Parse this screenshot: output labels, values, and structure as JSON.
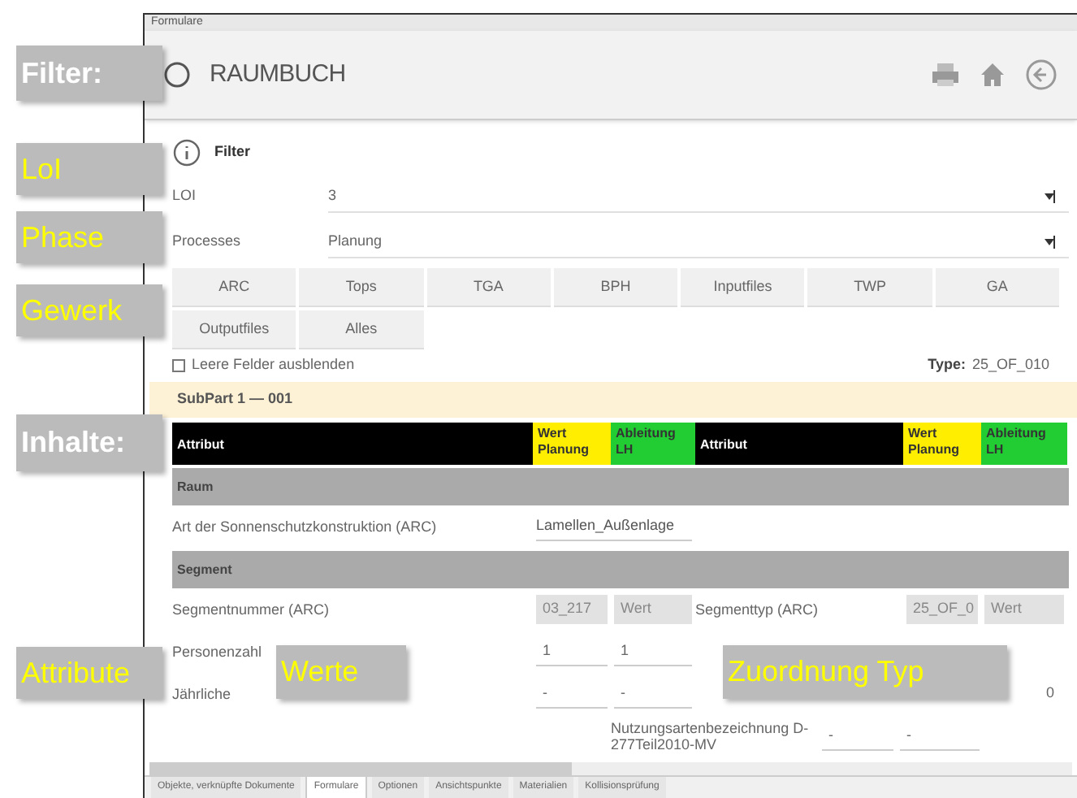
{
  "window": {
    "title": "Formulare"
  },
  "header": {
    "title": "RAUMBUCH"
  },
  "filter": {
    "title": "Filter",
    "fields": [
      {
        "label": "LOI",
        "value": "3"
      },
      {
        "label": "Processes",
        "value": "Planung"
      }
    ],
    "trade_buttons": [
      {
        "label": "ARC"
      },
      {
        "label": "Tops"
      },
      {
        "label": "TGA"
      },
      {
        "label": "BPH"
      },
      {
        "label": "Inputfiles"
      },
      {
        "label": "TWP"
      },
      {
        "label": "GA"
      },
      {
        "label": "Outputfiles"
      },
      {
        "label": "Alles"
      }
    ],
    "hide_empty": {
      "label": "Leere Felder ausblenden",
      "checked": false
    },
    "type": {
      "label": "Type:",
      "value": "25_OF_010"
    }
  },
  "subpart": "SubPart 1 — 001",
  "table": {
    "columns": [
      "Attribut",
      "Wert Planung",
      "Ableitung LH",
      "Attribut",
      "Wert Planung",
      "Ableitung LH"
    ],
    "sections": [
      {
        "title": "Raum",
        "rows": [
          {
            "cells": [
              {
                "text": "Art der Sonnenschutzkonstruktion (ARC)",
                "kind": "label"
              },
              {
                "text": "Lamellen_Außenlage",
                "kind": "wide"
              },
              {
                "kind": "empty"
              },
              {
                "kind": "empty"
              },
              {
                "kind": "empty"
              }
            ]
          }
        ]
      },
      {
        "title": "Segment",
        "rows": [
          {
            "cells": [
              {
                "text": "Segmentnummer (ARC)",
                "kind": "label"
              },
              {
                "text": "03_217",
                "kind": "filled"
              },
              {
                "text": "Wert",
                "kind": "filled"
              },
              {
                "text": "Segmenttyp (ARC)",
                "kind": "label"
              },
              {
                "text": "25_OF_0",
                "kind": "filled"
              },
              {
                "text": "Wert",
                "kind": "filled"
              }
            ]
          },
          {
            "cells": [
              {
                "text": "Personenzahl",
                "kind": "label"
              },
              {
                "text": "1",
                "kind": "input"
              },
              {
                "text": "1",
                "kind": "input"
              },
              {
                "kind": "empty"
              },
              {
                "kind": "empty"
              },
              {
                "kind": "empty"
              }
            ]
          },
          {
            "cells": [
              {
                "text": "Jährliche",
                "kind": "label"
              },
              {
                "text": "-",
                "kind": "input"
              },
              {
                "text": "-",
                "kind": "input"
              },
              {
                "kind": "empty"
              },
              {
                "kind": "empty"
              },
              {
                "text": "0",
                "kind": "plain"
              }
            ]
          },
          {
            "cells": [
              {
                "kind": "empty"
              },
              {
                "kind": "empty"
              },
              {
                "kind": "empty"
              },
              {
                "text": "Nutzungsartenbezeichnung D-277Teil2010-MV",
                "kind": "label"
              },
              {
                "text": "-",
                "kind": "input"
              },
              {
                "text": "-",
                "kind": "input"
              }
            ]
          }
        ]
      }
    ]
  },
  "bottom_tabs": [
    {
      "label": "Objekte, verknüpfte Dokumente",
      "selected": false
    },
    {
      "label": "Formulare",
      "selected": true
    },
    {
      "label": "Optionen",
      "selected": false
    },
    {
      "label": "Ansichtspunkte",
      "selected": false
    },
    {
      "label": "Materialien",
      "selected": false
    },
    {
      "label": "Kollisionsprüfung",
      "selected": false
    }
  ],
  "callouts": [
    {
      "text": "Filter:",
      "kind": "heading"
    },
    {
      "text": "LoI",
      "kind": "item"
    },
    {
      "text": "Phase",
      "kind": "item"
    },
    {
      "text": "Gewerk",
      "kind": "item"
    },
    {
      "text": "Inhalte:",
      "kind": "heading"
    },
    {
      "text": "Attribute",
      "kind": "item"
    },
    {
      "text": "Werte",
      "kind": "item"
    },
    {
      "text": "Zuordnung Typ",
      "kind": "item"
    }
  ]
}
